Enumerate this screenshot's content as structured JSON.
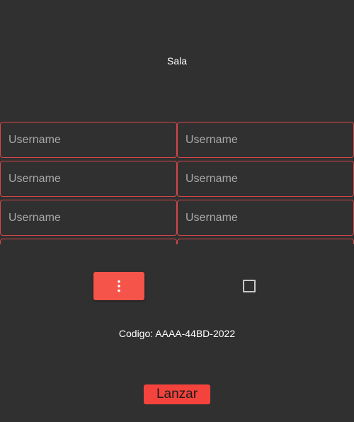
{
  "room": {
    "title": "Sala"
  },
  "players": {
    "placeholder": "Username",
    "left": [
      "",
      "",
      "",
      ""
    ],
    "right": [
      "",
      "",
      "",
      ""
    ]
  },
  "controls": {
    "menu_icon": "more-vert-icon",
    "checkbox_checked": false,
    "accent_color": "#f4544a"
  },
  "code": {
    "label": "Codigo: AAAA-44BD-2022"
  },
  "actions": {
    "launch_label": "Lanzar"
  }
}
